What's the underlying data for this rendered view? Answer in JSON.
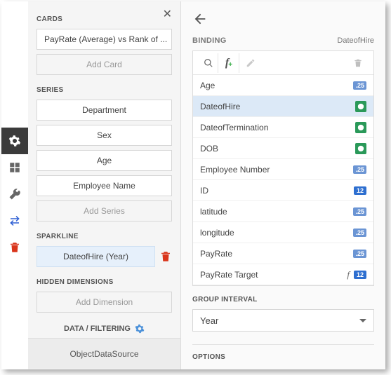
{
  "rail": {
    "gear": "gear",
    "layout": "layout",
    "wrench": "wrench",
    "swap": "swap",
    "delete": "delete"
  },
  "left": {
    "cards_label": "CARDS",
    "card_item": "PayRate (Average) vs Rank of ...",
    "add_card": "Add Card",
    "series_label": "SERIES",
    "series": [
      "Department",
      "Sex",
      "Age",
      "Employee Name"
    ],
    "add_series": "Add Series",
    "sparkline_label": "SPARKLINE",
    "sparkline_item": "DateofHire (Year)",
    "hidden_label": "HIDDEN DIMENSIONS",
    "add_dimension": "Add Dimension",
    "data_filter": "DATA / FILTERING",
    "datasource": "ObjectDataSource"
  },
  "right": {
    "binding_label": "BINDING",
    "binding_value": "DateofHire",
    "fields": [
      {
        "name": "Age",
        "badge": ".25",
        "btype": "num"
      },
      {
        "name": "DateofHire",
        "badge": "clock",
        "btype": "clock",
        "selected": true
      },
      {
        "name": "DateofTermination",
        "badge": "clock",
        "btype": "clock"
      },
      {
        "name": "DOB",
        "badge": "clock",
        "btype": "clock"
      },
      {
        "name": "Employee Number",
        "badge": ".25",
        "btype": "num"
      },
      {
        "name": "ID",
        "badge": "12",
        "btype": "cal"
      },
      {
        "name": "latitude",
        "badge": ".25",
        "btype": "num"
      },
      {
        "name": "longitude",
        "badge": ".25",
        "btype": "num"
      },
      {
        "name": "PayRate",
        "badge": ".25",
        "btype": "num"
      },
      {
        "name": "PayRate Target",
        "badge": "12",
        "btype": "cal",
        "fx": true
      }
    ],
    "group_interval_label": "GROUP INTERVAL",
    "group_interval_value": "Year",
    "options_label": "OPTIONS"
  }
}
